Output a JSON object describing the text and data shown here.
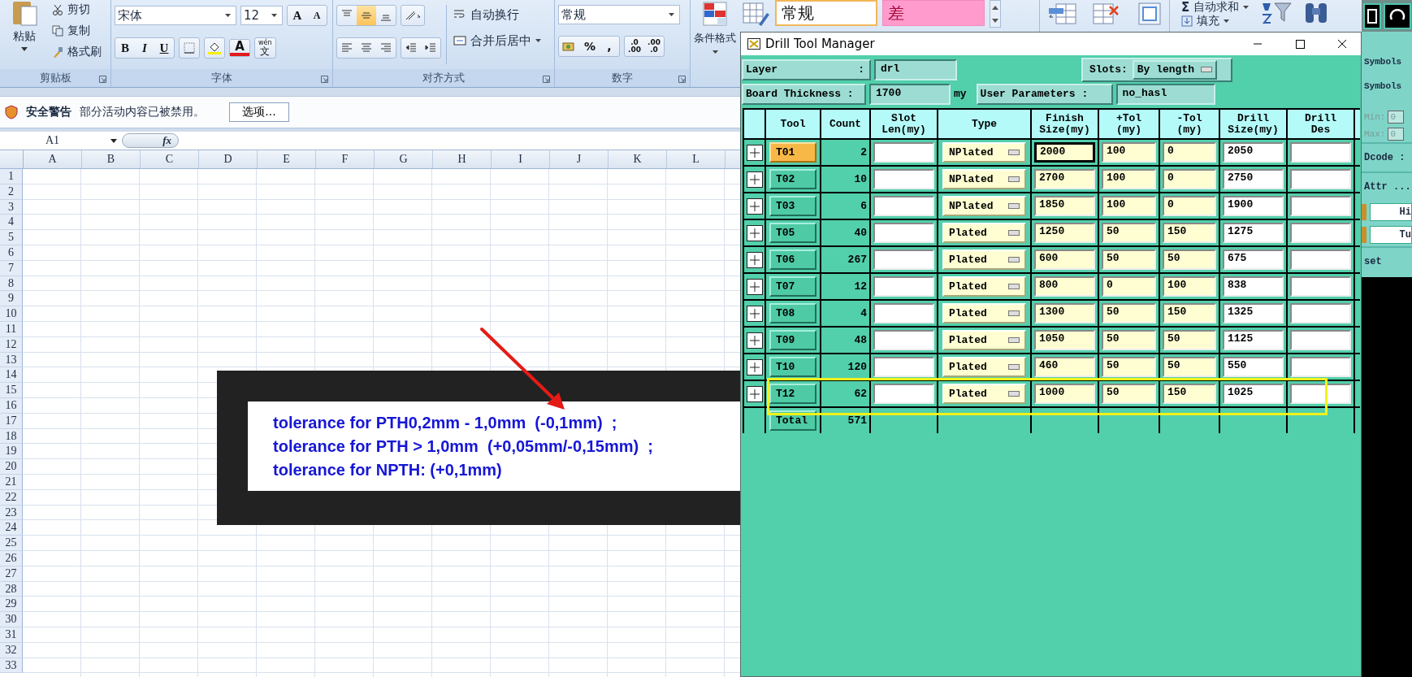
{
  "excel": {
    "ribbon": {
      "clipboard": {
        "paste": "粘贴",
        "cut": "剪切",
        "copy": "复制",
        "format_painter": "格式刷",
        "label": "剪贴板"
      },
      "font": {
        "name": "宋体",
        "size": "12",
        "grow": "A",
        "shrink": "A",
        "bold": "B",
        "italic": "I",
        "underline": "U",
        "font_color": "A",
        "phonetic_top": "wén",
        "phonetic": "文",
        "label": "字体"
      },
      "alignment": {
        "vertical": [
          {
            "kind": "top",
            "selected": false
          },
          {
            "kind": "middle",
            "selected": true
          },
          {
            "kind": "bottom",
            "selected": false
          }
        ],
        "wrap": "自动换行",
        "merge": "合并后居中",
        "label": "对齐方式"
      },
      "number": {
        "format": "常规",
        "percent": "%",
        "comma": ",",
        "increase_decimal": [
          ".0",
          ".00"
        ],
        "decrease_decimal": [
          ".00",
          ".0"
        ],
        "label": "数字"
      },
      "styles": {
        "conditional": "条件格式",
        "gallery": [
          {
            "kind": "normal",
            "label": "常规"
          },
          {
            "kind": "bad",
            "label": "差"
          }
        ]
      },
      "editing": {
        "autosum_symbol": "Σ",
        "autosum": "自动求和",
        "fill": "填充"
      }
    },
    "security_bar": {
      "title": "安全警告",
      "message": "部分活动内容已被禁用。",
      "button": "选项..."
    },
    "formula_bar": {
      "name_box": "A1",
      "fx": "fx"
    },
    "sheet": {
      "columns": [
        "A",
        "B",
        "C",
        "D",
        "E",
        "F",
        "G",
        "H",
        "I",
        "J",
        "K",
        "L"
      ],
      "rows": [
        "1",
        "2",
        "3",
        "4",
        "5",
        "6",
        "7",
        "8",
        "9",
        "10",
        "11",
        "12",
        "13",
        "14",
        "15",
        "16",
        "17",
        "18",
        "19",
        "20",
        "21",
        "22",
        "23",
        "24",
        "25",
        "26",
        "27",
        "28",
        "29",
        "30",
        "31",
        "32",
        "33"
      ],
      "note": {
        "lines": [
          "tolerance for PTH0,2mm - 1,0mm  (-0,1mm)  ;",
          "tolerance for PTH > 1,0mm  (+0,05mm/-0,15mm)  ;",
          "tolerance for NPTH: (+0,1mm)"
        ]
      }
    }
  },
  "drill_manager": {
    "title": "Drill Tool Manager",
    "layer": {
      "label": "Layer",
      "separator": ":",
      "value": "drl"
    },
    "slots": {
      "label": "Slots:",
      "value": "By length"
    },
    "board_thickness": {
      "label": "Board Thickness :",
      "value": "1700",
      "unit": "my"
    },
    "user_parameters": {
      "label": "User Parameters :",
      "value": "no_hasl"
    },
    "columns": [
      "",
      "Tool",
      "Count",
      "Slot\nLen(my)",
      "Type",
      "Finish\nSize(my)",
      "+Tol\n(my)",
      "-Tol\n(my)",
      "Drill\nSize(my)",
      "Drill\nDes"
    ],
    "rows": [
      {
        "tool": "T01",
        "selected": true,
        "focused": true,
        "highlighted": false,
        "count": "2",
        "type": "NPlated",
        "finish": "2000",
        "plus_tol": "100",
        "minus_tol": "0",
        "drill_size": "2050"
      },
      {
        "tool": "T02",
        "selected": false,
        "focused": false,
        "highlighted": false,
        "count": "10",
        "type": "NPlated",
        "finish": "2700",
        "plus_tol": "100",
        "minus_tol": "0",
        "drill_size": "2750"
      },
      {
        "tool": "T03",
        "selected": false,
        "focused": false,
        "highlighted": false,
        "count": "6",
        "type": "NPlated",
        "finish": "1850",
        "plus_tol": "100",
        "minus_tol": "0",
        "drill_size": "1900"
      },
      {
        "tool": "T05",
        "selected": false,
        "focused": false,
        "highlighted": false,
        "count": "40",
        "type": "Plated",
        "finish": "1250",
        "plus_tol": "50",
        "minus_tol": "150",
        "drill_size": "1275"
      },
      {
        "tool": "T06",
        "selected": false,
        "focused": false,
        "highlighted": false,
        "count": "267",
        "type": "Plated",
        "finish": "600",
        "plus_tol": "50",
        "minus_tol": "50",
        "drill_size": "675"
      },
      {
        "tool": "T07",
        "selected": false,
        "focused": false,
        "highlighted": false,
        "count": "12",
        "type": "Plated",
        "finish": "800",
        "plus_tol": "0",
        "minus_tol": "100",
        "drill_size": "838"
      },
      {
        "tool": "T08",
        "selected": false,
        "focused": false,
        "highlighted": false,
        "count": "4",
        "type": "Plated",
        "finish": "1300",
        "plus_tol": "50",
        "minus_tol": "150",
        "drill_size": "1325"
      },
      {
        "tool": "T09",
        "selected": false,
        "focused": false,
        "highlighted": false,
        "count": "48",
        "type": "Plated",
        "finish": "1050",
        "plus_tol": "50",
        "minus_tol": "50",
        "drill_size": "1125"
      },
      {
        "tool": "T10",
        "selected": false,
        "focused": false,
        "highlighted": false,
        "count": "120",
        "type": "Plated",
        "finish": "460",
        "plus_tol": "50",
        "minus_tol": "50",
        "drill_size": "550"
      },
      {
        "tool": "T12",
        "selected": false,
        "focused": false,
        "highlighted": true,
        "count": "62",
        "type": "Plated",
        "finish": "1000",
        "plus_tol": "50",
        "minus_tol": "150",
        "drill_size": "1025"
      }
    ],
    "total": {
      "label": "Total",
      "count": "571"
    }
  },
  "side_panel": {
    "items": [
      {
        "kind": "button",
        "label": "Symbols",
        "disabled": false
      },
      {
        "kind": "button",
        "label": "Symbols",
        "disabled": false
      },
      {
        "kind": "range",
        "label": "Min:",
        "value": "0",
        "disabled": true
      },
      {
        "kind": "range",
        "label": "Max:",
        "value": "0",
        "disabled": true
      },
      {
        "kind": "label",
        "label": "Dcode :",
        "disabled": false
      },
      {
        "kind": "label",
        "label": "Attr ...",
        "disabled": false
      },
      {
        "kind": "toggle",
        "label": "Hi",
        "disabled": false
      },
      {
        "kind": "toggle",
        "label": "Tu",
        "disabled": false
      },
      {
        "kind": "label",
        "label": "set",
        "disabled": false
      }
    ]
  }
}
